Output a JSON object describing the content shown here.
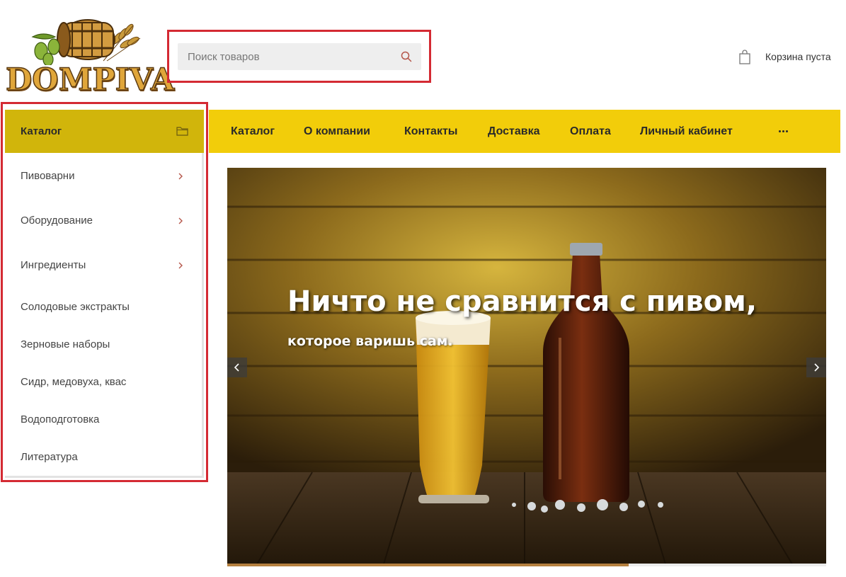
{
  "header": {
    "logo_text": "DOMPIVA",
    "search": {
      "placeholder": "Поиск товаров",
      "icon": "search-icon"
    },
    "cart": {
      "label": "Корзина пуста",
      "icon": "shopping-bag-icon"
    }
  },
  "nav": {
    "items": [
      {
        "label": "Каталог"
      },
      {
        "label": "О компании"
      },
      {
        "label": "Контакты"
      },
      {
        "label": "Доставка"
      },
      {
        "label": "Оплата"
      },
      {
        "label": "Личный кабинет"
      }
    ],
    "more_icon": "more-dots-icon"
  },
  "catalog": {
    "title": "Каталог",
    "icon": "folder-icon",
    "items": [
      {
        "label": "Пивоварни",
        "has_submenu": true
      },
      {
        "label": "Оборудование",
        "has_submenu": true
      },
      {
        "label": "Ингредиенты",
        "has_submenu": true
      },
      {
        "label": "Солодовые экстракты",
        "has_submenu": false
      },
      {
        "label": "Зерновые наборы",
        "has_submenu": false
      },
      {
        "label": "Сидр, медовуха, квас",
        "has_submenu": false
      },
      {
        "label": "Водоподготовка",
        "has_submenu": false
      },
      {
        "label": "Литература",
        "has_submenu": false
      }
    ]
  },
  "slider": {
    "title": "Ничто не сравнится с пивом,",
    "subtitle": "которое варишь сам.",
    "progress": 0.67
  },
  "colors": {
    "nav_bg": "#f2cd0a",
    "catalog_header_bg": "#d1b50b",
    "highlight_border": "#d42a33",
    "logo_gold": "#e0a63a",
    "progress": "#b5803f"
  }
}
